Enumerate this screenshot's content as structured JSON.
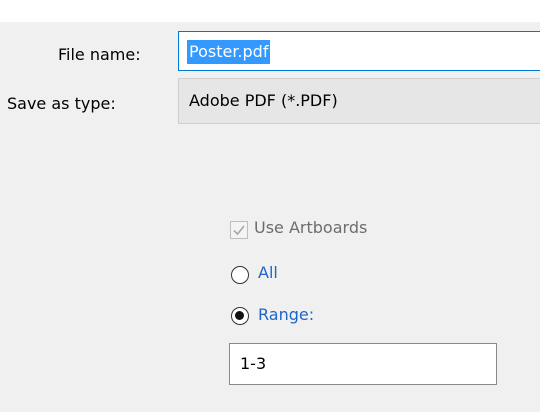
{
  "dialog": {
    "file_name_label": "File name:",
    "file_name_value": "Poster.pdf",
    "save_as_type_label": "Save as type:",
    "save_as_type_value": "Adobe PDF (*.PDF)"
  },
  "options": {
    "use_artboards_label": "Use Artboards",
    "use_artboards_checked": true,
    "use_artboards_enabled": false,
    "all_label": "All",
    "range_label": "Range:",
    "selected_option": "Range",
    "range_value": "1-3"
  },
  "colors": {
    "selection": "#3399ff",
    "link_blue": "#1c66c7",
    "focus_border": "#0078d7"
  }
}
